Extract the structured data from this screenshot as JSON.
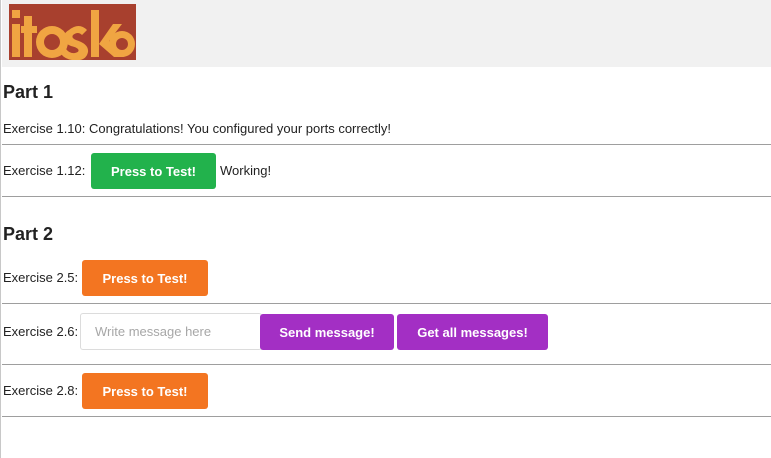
{
  "header": {
    "logo_text": "itoska"
  },
  "part1": {
    "title": "Part 1",
    "ex110": {
      "text": "Exercise 1.10: Congratulations! You configured your ports correctly!"
    },
    "ex112": {
      "label": "Exercise 1.12:",
      "button_label": "Press to Test!",
      "status": "Working!"
    }
  },
  "part2": {
    "title": "Part 2",
    "ex25": {
      "label": "Exercise 2.5:",
      "button_label": "Press to Test!"
    },
    "ex26": {
      "label": "Exercise 2.6:",
      "input_value": "",
      "input_placeholder": "Write message here",
      "send_label": "Send message!",
      "get_label": "Get all messages!"
    },
    "ex28": {
      "label": "Exercise 2.8:",
      "button_label": "Press to Test!"
    }
  },
  "colors": {
    "green": "#22b24c",
    "orange": "#f37521",
    "purple": "#a32fc4",
    "logo_dark": "#a8402e",
    "logo_light": "#f0a542"
  }
}
